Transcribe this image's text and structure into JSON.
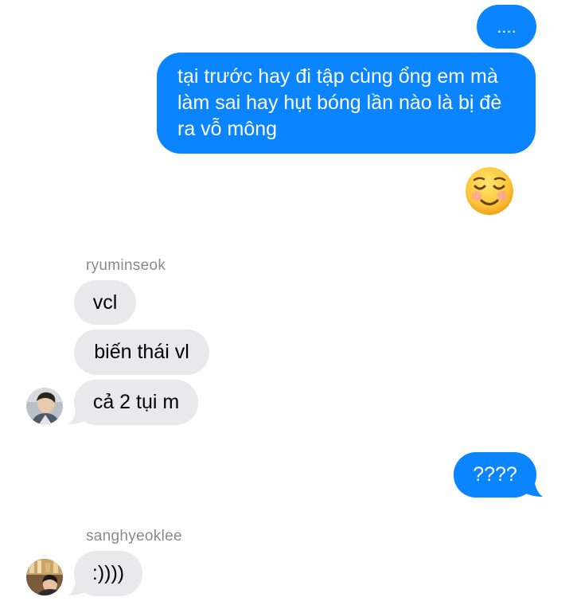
{
  "conversation": {
    "messages": [
      {
        "from": "me",
        "text": "...."
      },
      {
        "from": "me",
        "text": "tại trước hay đi tập cùng ổng em mà làm sai hay hụt bóng lần nào là bị đè ra vỗ mông"
      },
      {
        "from": "me",
        "emoji": "☺️"
      },
      {
        "from": "ryuminseok",
        "text": "vcl"
      },
      {
        "from": "ryuminseok",
        "text": "biến thái vl"
      },
      {
        "from": "ryuminseok",
        "text": "cả 2 tụi m"
      },
      {
        "from": "me",
        "text": "????"
      },
      {
        "from": "sanghyeoklee",
        "text": ":))))"
      }
    ],
    "senders": {
      "ryuminseok": "ryuminseok",
      "sanghyeoklee": "sanghyeoklee"
    },
    "long_message_lines": [
      "tại trước hay đi tập cùng ổng em mà",
      "làm sai hay hụt bóng lần nào là bị đè",
      "ra vỗ mông"
    ]
  },
  "colors": {
    "outgoing_bubble": "#0a84ff",
    "incoming_bubble": "#e9e9eb",
    "sender_name": "#8a8a8e"
  },
  "icons": {
    "emoji": "smiling-face-icon",
    "avatar_1": "avatar-ryuminseok",
    "avatar_2": "avatar-sanghyeoklee"
  }
}
